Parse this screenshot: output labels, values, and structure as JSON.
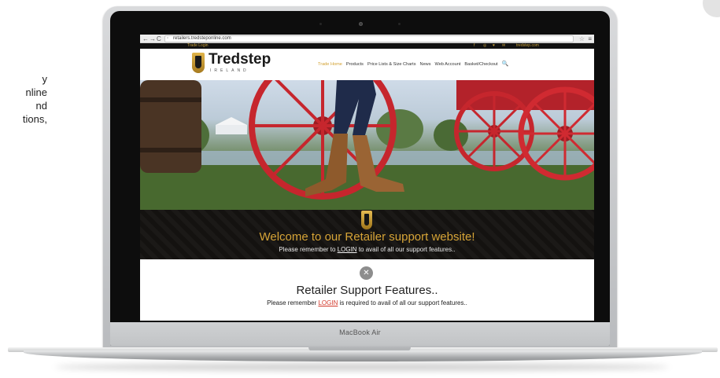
{
  "side_caption": {
    "lines": [
      "y",
      "nline",
      "nd",
      "tions,"
    ]
  },
  "laptop": {
    "model_name": "MacBook Air"
  },
  "browser": {
    "back": "←",
    "forward": "→",
    "reload": "C",
    "url": "retailers.tredsteponline.com",
    "star": "☆",
    "menu": "≡"
  },
  "site": {
    "top_bar": {
      "trade_login": "Trade Login",
      "social": [
        "f",
        "◎",
        "♥",
        "✉"
      ],
      "email": "tredstep.com"
    },
    "logo": {
      "name": "Tredstep",
      "sub": "IRELAND"
    },
    "nav": [
      "Trade Home",
      "Products",
      "Price Lists & Size Charts",
      "News",
      "Web Account",
      "Basket/Checkout"
    ],
    "nav_search": "🔍",
    "welcome": {
      "title": "Welcome to our Retailer support website!",
      "sub_before": "Please remember to ",
      "sub_link": "LOGIN",
      "sub_after": " to avail of all our support features.."
    },
    "features": {
      "icon": "✕",
      "title": "Retailer Support Features..",
      "sub_before": "Please remember ",
      "sub_link": "LOGIN",
      "sub_after": " is required to avail of all our support features.."
    }
  },
  "colors": {
    "accent_gold": "#d6a437",
    "login_red": "#d2382a",
    "band_dark": "#141210",
    "wheel_red": "#c6262d"
  }
}
